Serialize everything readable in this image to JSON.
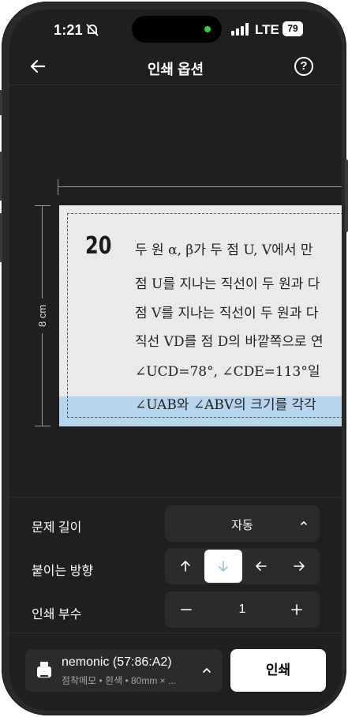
{
  "status_bar": {
    "time": "1:21",
    "network": "LTE",
    "battery": "79"
  },
  "header": {
    "title": "인쇄 옵션",
    "help_label": "?"
  },
  "preview": {
    "ruler_label": "8 cm",
    "question_number": "20",
    "question_lines": [
      "두 원 α, β가 두 점 U, V에서 만",
      "점 U를 지나는 직선이 두 원과 다",
      "점 V를 지나는 직선이 두 원과 다",
      "직선 VD를 점 D의 바깥쪽으로 연",
      "∠UCD=78°,  ∠CDE=113°일",
      "∠UAB와 ∠ABV의 크기를 각각"
    ]
  },
  "options": {
    "length": {
      "label": "문제 길이",
      "value": "자동"
    },
    "direction": {
      "label": "붙이는 방향",
      "buttons": [
        "up-arrow-icon",
        "down-arrow-icon",
        "left-arrow-icon",
        "right-arrow-icon"
      ],
      "selected": "down"
    },
    "copies": {
      "label": "인쇄 부수",
      "value": "1",
      "minus": "−",
      "plus": "+"
    }
  },
  "bottom": {
    "printer_name": "nemonic (57:86:A2)",
    "printer_sub": "점착메모 • 흰색 • 80mm × ...",
    "print_label": "인쇄"
  },
  "colors": {
    "background": "#1f1f21",
    "panel": "#2b2b2e",
    "accent_selected": "#ffffff",
    "selected_arrow": "#8fc6d8"
  }
}
